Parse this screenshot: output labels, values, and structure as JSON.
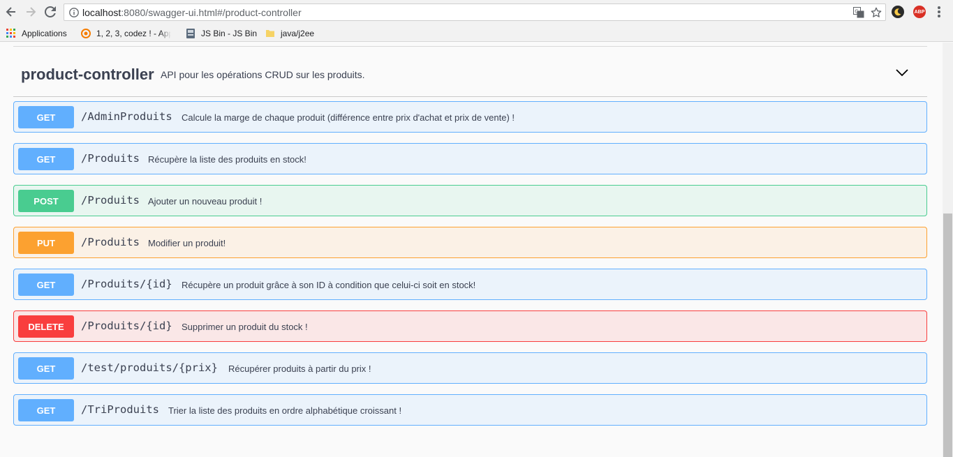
{
  "browser": {
    "url_host": "localhost",
    "url_rest": ":8080/swagger-ui.html#/product-controller",
    "ext_abp_label": "ABP"
  },
  "bookmarks": [
    {
      "label": "Applications"
    },
    {
      "label": "1, 2, 3, codez ! - App"
    },
    {
      "label": "JS Bin - JS Bin"
    },
    {
      "label": "java/j2ee"
    }
  ],
  "tag": {
    "name": "product-controller",
    "description": "API pour les opérations CRUD sur les produits."
  },
  "operations": [
    {
      "method": "GET",
      "path": "/AdminProduits",
      "summary": "Calcule la marge de chaque produit (différence entre prix d'achat et prix de vente) !"
    },
    {
      "method": "GET",
      "path": "/Produits",
      "summary": "Récupère la liste des produits en stock!"
    },
    {
      "method": "POST",
      "path": "/Produits",
      "summary": "Ajouter un nouveau produit !"
    },
    {
      "method": "PUT",
      "path": "/Produits",
      "summary": "Modifier un produit!"
    },
    {
      "method": "GET",
      "path": "/Produits/{id}",
      "summary": "Récupère un produit grâce à son ID à condition que celui-ci soit en stock!"
    },
    {
      "method": "DELETE",
      "path": "/Produits/{id}",
      "summary": "Supprimer un produit du stock !"
    },
    {
      "method": "GET",
      "path": "/test/produits/{prix}",
      "summary": "Récupérer produits à partir du prix !"
    },
    {
      "method": "GET",
      "path": "/TriProduits",
      "summary": "Trier la liste des produits en ordre alphabétique croissant !"
    }
  ],
  "colors": {
    "get": "#61affe",
    "post": "#49cc90",
    "put": "#fca130",
    "delete": "#f93e3e",
    "text": "#3b4151"
  }
}
